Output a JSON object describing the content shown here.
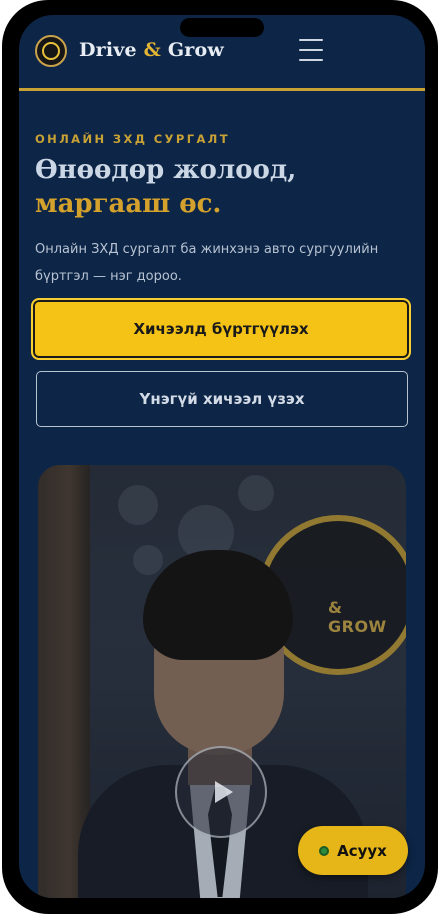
{
  "header": {
    "brand_part1": "Drive",
    "brand_amp": "&",
    "brand_part2": "Grow",
    "logo_icon": "drive-grow-logo",
    "menu_icon": "hamburger-menu-icon"
  },
  "hero": {
    "eyebrow": "ОНЛАЙН ЗХД СУРГАЛТ",
    "title_line1": "Өнөөдөр жолоод,",
    "title_line2": "маргааш өс.",
    "description": "Онлайн ЗХД сургалт ба жинхэнэ авто сургуулийн бүртгэл — нэг дороо.",
    "primary_button": "Хичээлд бүртгүүлэх",
    "secondary_button": "Үнэгүй хичээл үзэх"
  },
  "video": {
    "play_icon": "play-icon",
    "sign_text": "& GROW"
  },
  "chat": {
    "ask_label": "Асуух",
    "status_color": "#2e8b3c"
  },
  "colors": {
    "background": "#0d2546",
    "accent": "#f4c316",
    "gold_text": "#d4a22c"
  }
}
